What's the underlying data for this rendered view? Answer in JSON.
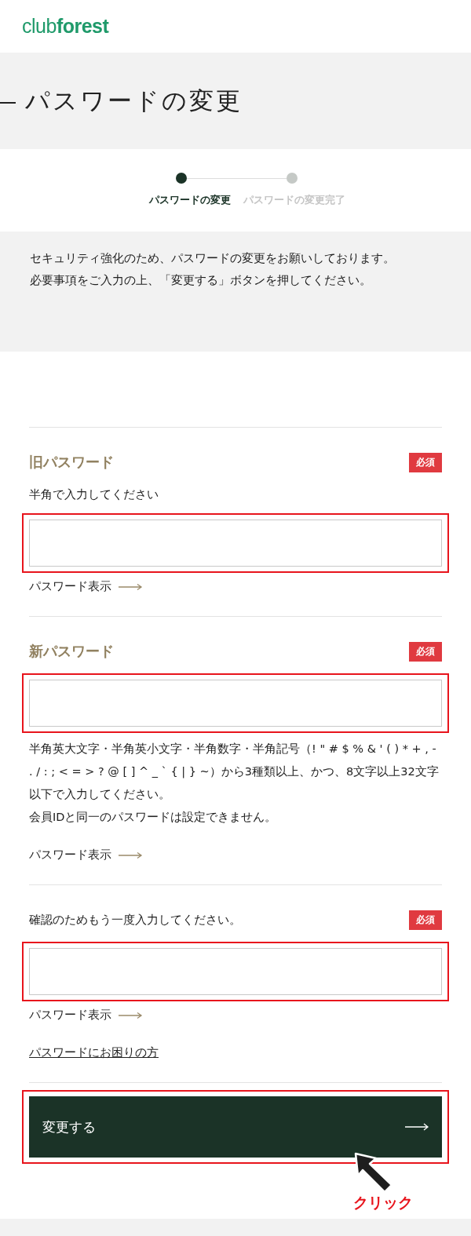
{
  "logo": "club**forest**",
  "title": "パスワードの変更",
  "steps": [
    {
      "label": "パスワードの変更",
      "selected": true
    },
    {
      "label": "パスワードの変更完了",
      "selected": false
    }
  ],
  "notice": [
    "セキュリティ強化のため、パスワードの変更をお願いしております。",
    "必要事項をご入力の上、「変更する」ボタンを押してください。"
  ],
  "fields": [
    {
      "label": "旧パスワード",
      "kind": "heading",
      "badge": "必須",
      "hint": "半角で入力してください",
      "toggle": "パスワード表示",
      "highlighted": true
    },
    {
      "label": "新パスワード",
      "kind": "heading",
      "badge": "必須",
      "notes": [
        "半角英大文字・半角英小文字・半角数字・半角記号（! \" # $ % & ' ( ) * + , - . / : ; < = > ? @ [ ] ^ _ ` { | } ~）から3種類以上、かつ、8文字以上32文字以下で入力してください。",
        "会員IDと同一のパスワードは設定できません。"
      ],
      "toggle": "パスワード表示",
      "highlighted": true
    },
    {
      "label": "確認のためもう一度入力してください。",
      "kind": "plain",
      "badge": "必須",
      "toggle": "パスワード表示",
      "highlighted": true
    }
  ],
  "help_link": "パスワードにお困りの方",
  "submit": {
    "label": "変更する",
    "highlighted": true
  },
  "annotation": "クリック"
}
